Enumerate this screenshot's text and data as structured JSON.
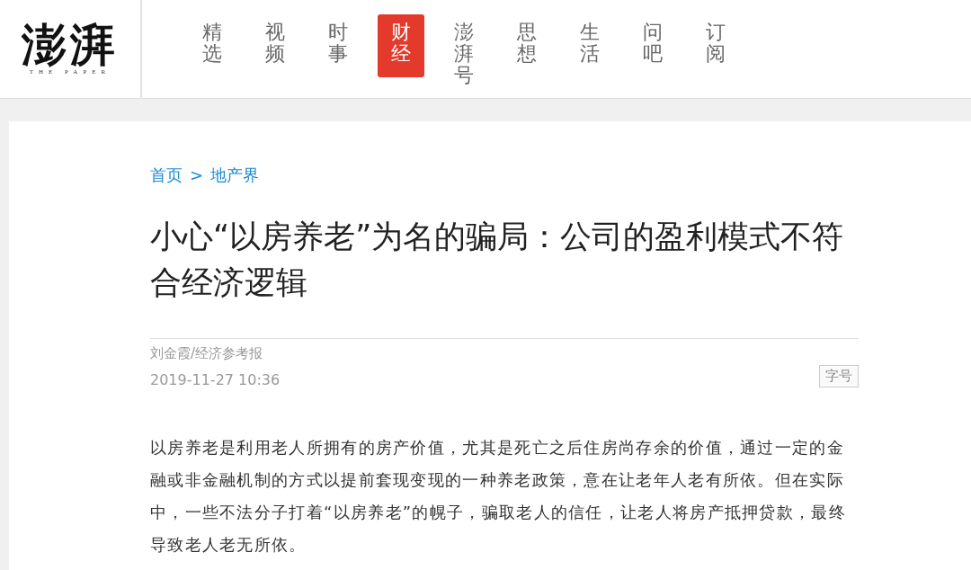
{
  "logo": {
    "name": "澎湃",
    "tagline": "THE PAPER"
  },
  "nav": [
    {
      "label": "精选",
      "selected": false
    },
    {
      "label": "视频",
      "selected": false
    },
    {
      "label": "时事",
      "selected": false
    },
    {
      "label": "财经",
      "selected": true
    },
    {
      "label": "澎湃号",
      "selected": false
    },
    {
      "label": "思想",
      "selected": false
    },
    {
      "label": "生活",
      "selected": false
    },
    {
      "label": "问吧",
      "selected": false
    },
    {
      "label": "订阅",
      "selected": false
    }
  ],
  "breadcrumb": {
    "home": "首页",
    "separator": ">",
    "section": "地产界"
  },
  "article": {
    "title": "小心“以房养老”为名的骗局：公司的盈利模式不符合经济逻辑",
    "author": "刘金霞/经济参考报",
    "date": "2019-11-27 10:36",
    "font_size_button": "字号",
    "paragraphs": [
      "以房养老是利用老人所拥有的房产价值，尤其是死亡之后住房尚存余的价值，通过一定的金融或非金融机制的方式以提前套现变现的一种养老政策，意在让老年人老有所依。但在实际中，一些不法分子打着“以房养老”的幌子，骗取老人的信任，让老人将房产抵押贷款，最终导致老人老无所依。"
    ]
  }
}
